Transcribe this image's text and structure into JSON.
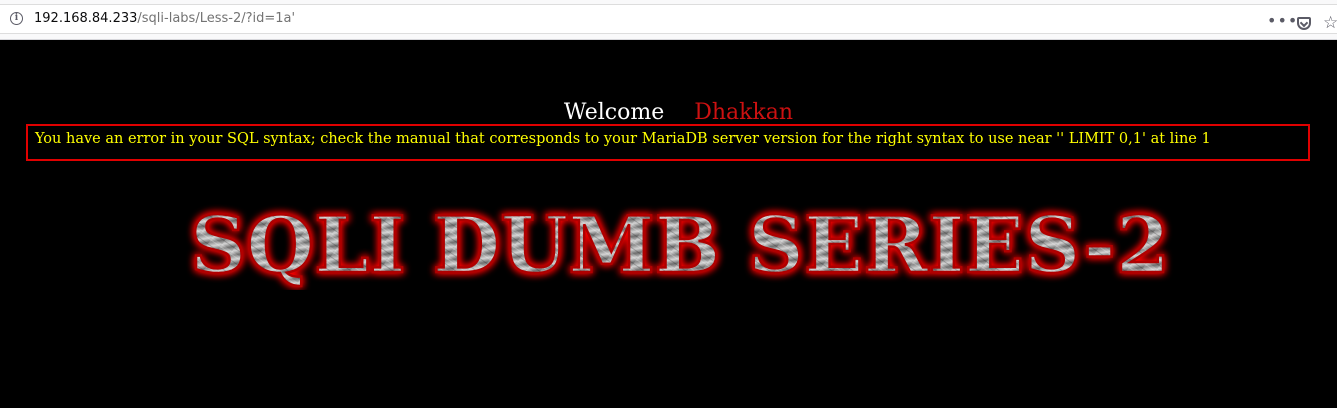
{
  "browser": {
    "url_host": "192.168.84.233",
    "url_path": "/sqli-labs/Less-2/?id=1a'",
    "info_icon": "info-icon",
    "more_icon": "more-actions-icon",
    "more_glyph": "•••",
    "pocket_icon": "pocket-icon",
    "bookmark_icon": "star-icon",
    "star_glyph": "☆"
  },
  "page": {
    "welcome_word": "Welcome",
    "user_name": "Dhakkan",
    "error_message": "You have an error in your SQL syntax; check the manual that corresponds to your MariaDB server version for the right syntax to use near '' LIMIT 0,1' at line 1",
    "logo_text": "SQLI DUMB SERIES-2",
    "colors": {
      "background": "#000000",
      "welcome": "#ffffff",
      "name": "#cc1111",
      "error_text": "#ffff00",
      "error_border": "#e00000"
    }
  }
}
